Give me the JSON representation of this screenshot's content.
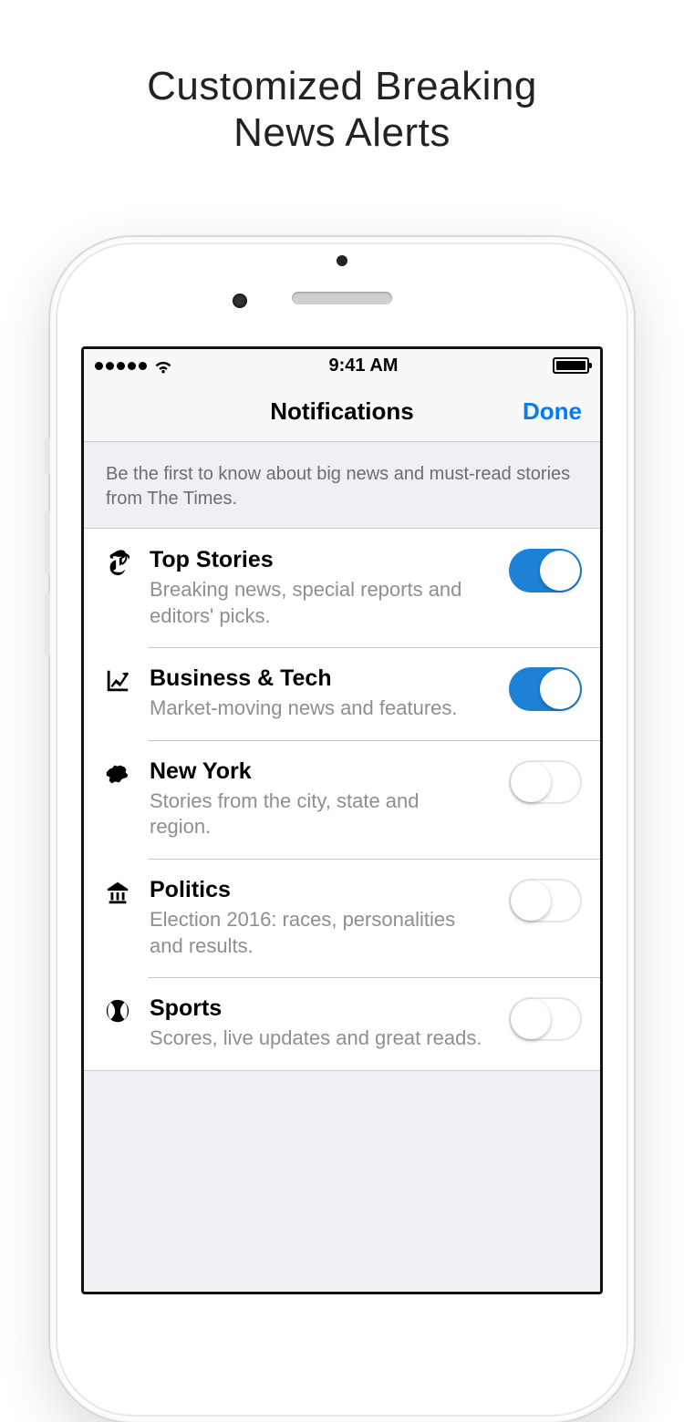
{
  "promo": {
    "title_line1": "Customized Breaking",
    "title_line2": "News Alerts"
  },
  "status": {
    "time": "9:41 AM"
  },
  "nav": {
    "title": "Notifications",
    "done": "Done"
  },
  "section": {
    "header": "Be the first to know about big news and must-read stories from The Times."
  },
  "rows": [
    {
      "icon": "nyt-t",
      "title": "Top Stories",
      "desc": "Breaking news, special reports and editors' picks.",
      "on": true
    },
    {
      "icon": "chart-up",
      "title": "Business & Tech",
      "desc": "Market-moving news and features.",
      "on": true
    },
    {
      "icon": "ny-state",
      "title": "New York",
      "desc": "Stories from the city, state and region.",
      "on": false
    },
    {
      "icon": "gov-building",
      "title": "Politics",
      "desc": "Election 2016: races, personalities and results.",
      "on": false
    },
    {
      "icon": "baseball",
      "title": "Sports",
      "desc": "Scores, live updates and great reads.",
      "on": false
    }
  ]
}
